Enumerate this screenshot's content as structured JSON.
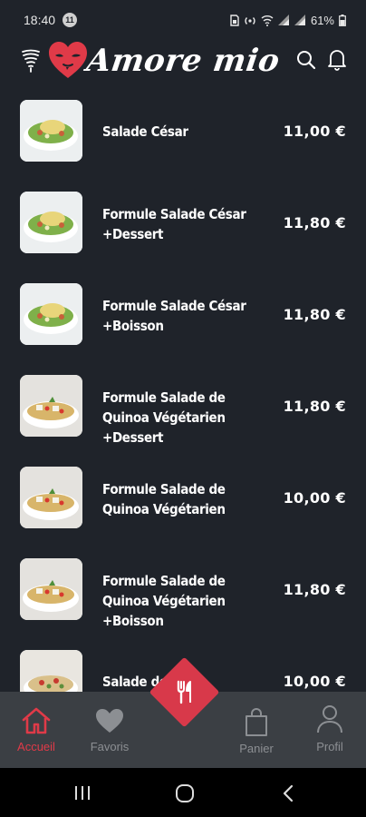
{
  "status_bar": {
    "time": "18:40",
    "notification_count": "11",
    "battery": "61%"
  },
  "header": {
    "brand": "Amore mio",
    "menu_icon": "menu-swirl-icon",
    "logo_icon": "heart-mask-icon",
    "search_icon": "search-icon",
    "bell_icon": "bell-icon"
  },
  "products": [
    {
      "name": "Salade César",
      "price": "11,00 €",
      "thumb": "caesar-salad-image"
    },
    {
      "name": "Formule Salade César +Dessert",
      "price": "11,80 €",
      "thumb": "caesar-salad-image"
    },
    {
      "name": "Formule Salade César +Boisson",
      "price": "11,80 €",
      "thumb": "caesar-salad-image"
    },
    {
      "name": "Formule Salade de Quinoa Végétarien +Dessert",
      "price": "11,80 €",
      "thumb": "quinoa-salad-image"
    },
    {
      "name": "Formule Salade de Quinoa Végétarien",
      "price": "10,00 €",
      "thumb": "quinoa-salad-image"
    },
    {
      "name": "Formule Salade de Quinoa Végétarien +Boisson",
      "price": "11,80 €",
      "thumb": "quinoa-salad-image"
    },
    {
      "name": "Salade de",
      "price": "10,00 €",
      "thumb": "mixed-salad-image"
    }
  ],
  "bottom_nav": {
    "home": "Accueil",
    "favorites": "Favoris",
    "cart": "Panier",
    "profile": "Profil"
  },
  "colors": {
    "background": "#1f232a",
    "accent": "#d8394a",
    "nav_background": "#3b3f44"
  }
}
